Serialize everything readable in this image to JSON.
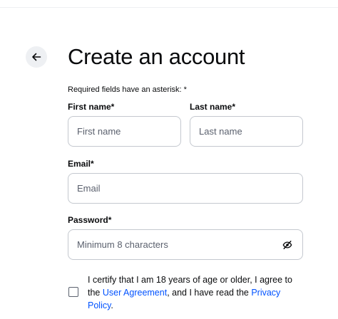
{
  "page": {
    "title": "Create an account",
    "required_note": "Required fields have an asterisk: *"
  },
  "icons": {
    "back": "arrow-left-icon",
    "password_toggle": "eye-off-icon"
  },
  "colors": {
    "text": "#0a0b0d",
    "link": "#0052ff",
    "border": "#c4c8cf",
    "placeholder": "#5b616e",
    "back_button_bg": "#eef0f3"
  },
  "form": {
    "first_name": {
      "label": "First name*",
      "placeholder": "First name",
      "value": ""
    },
    "last_name": {
      "label": "Last name*",
      "placeholder": "Last name",
      "value": ""
    },
    "email": {
      "label": "Email*",
      "placeholder": "Email",
      "value": ""
    },
    "password": {
      "label": "Password*",
      "placeholder": "Minimum 8 characters",
      "value": ""
    }
  },
  "terms": {
    "checked": false,
    "text_before": "I certify that I am 18 years of age or older, I agree to the ",
    "user_agreement_link": "User Agreement",
    "text_middle": ", and I have read the ",
    "privacy_policy_link": "Privacy Policy",
    "text_after": "."
  }
}
